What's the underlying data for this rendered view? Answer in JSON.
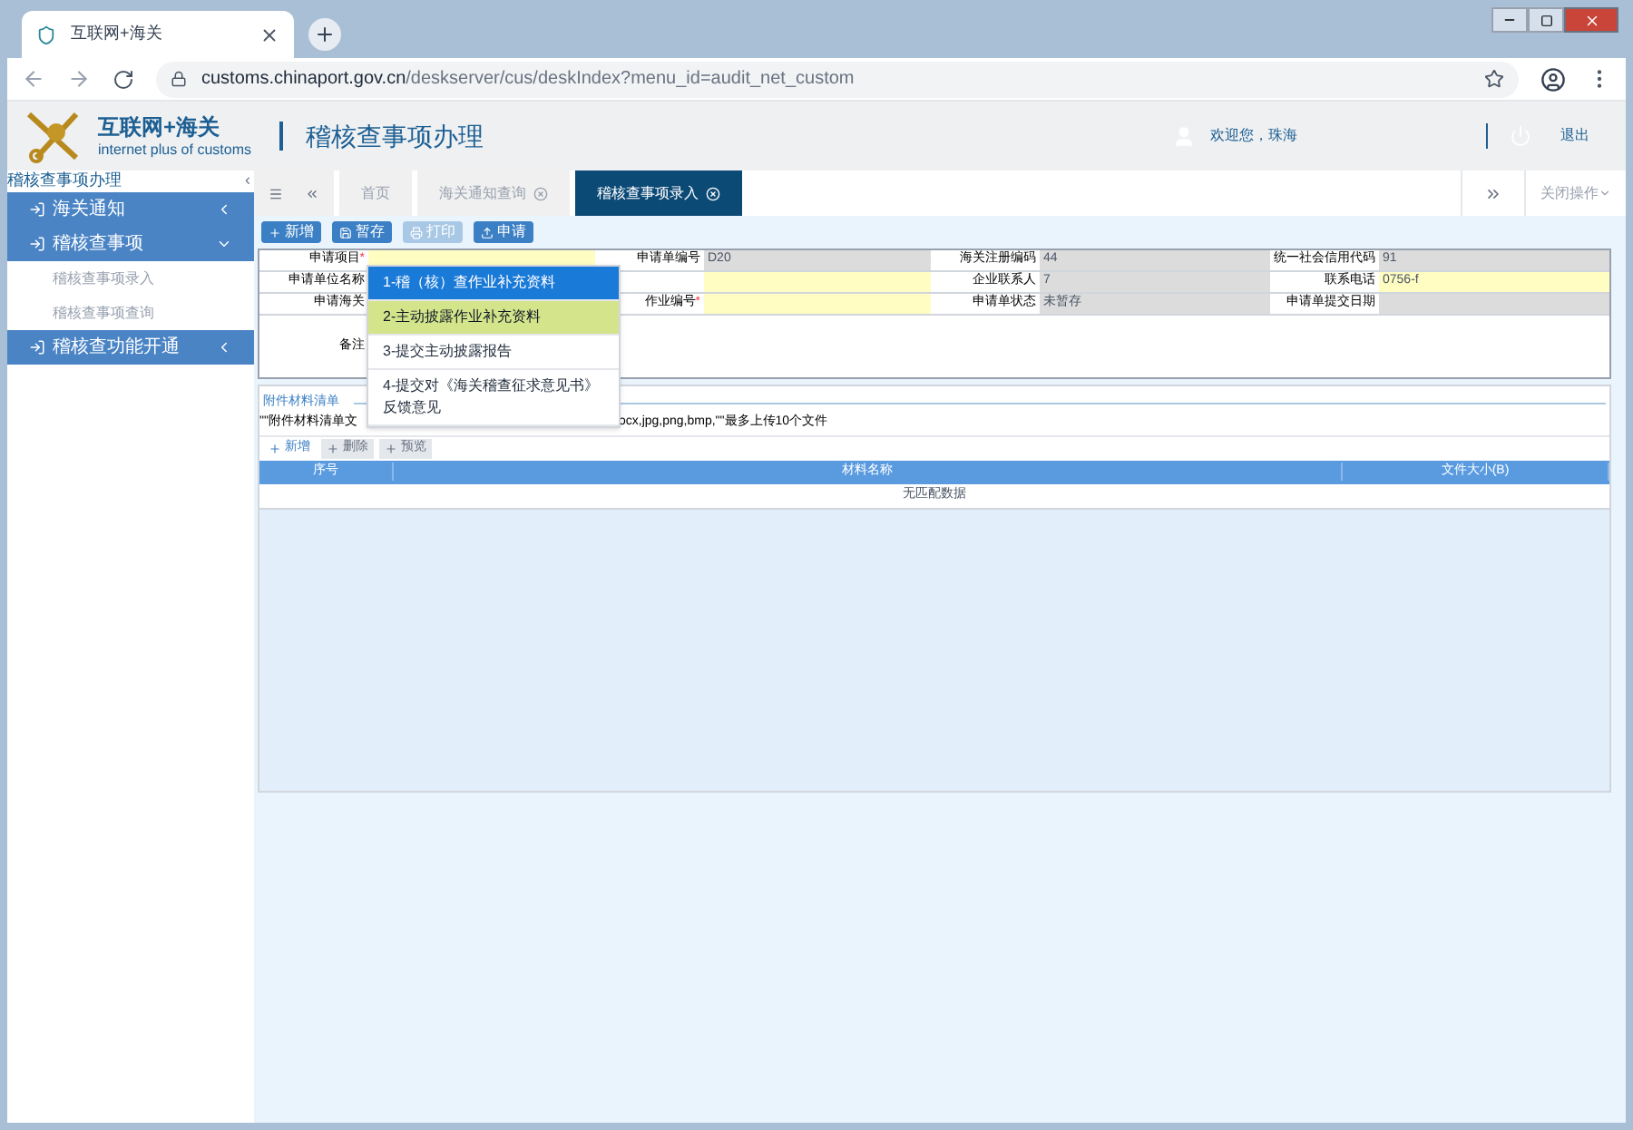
{
  "browser": {
    "tab_title": "互联网+海关",
    "url_host": "customs.chinaport.gov.cn",
    "url_path": "/deskserver/cus/deskIndex?menu_id=audit_net_custom"
  },
  "header": {
    "logo_title": "互联网+海关",
    "logo_subtitle": "internet plus of customs",
    "page_title": "稽核查事项办理",
    "welcome": "欢迎您，珠海",
    "logout": "退出"
  },
  "sidebar": {
    "title": "稽核查事项办理",
    "collapse": "‹",
    "items": [
      {
        "label": "海关通知",
        "expanded": false
      },
      {
        "label": "稽核查事项",
        "expanded": true,
        "children": [
          {
            "label": "稽核查事项录入"
          },
          {
            "label": "稽核查事项查询"
          }
        ]
      },
      {
        "label": "稽核查功能开通",
        "expanded": false
      }
    ]
  },
  "tabs": [
    {
      "label": "首页",
      "selected": false,
      "closable": false
    },
    {
      "label": "海关通知查询",
      "selected": false,
      "closable": true
    },
    {
      "label": "稽核查事项录入",
      "selected": true,
      "closable": true
    }
  ],
  "close_ops": "关闭操作",
  "toolbar": [
    {
      "label": "新增",
      "disabled": false
    },
    {
      "label": "暂存",
      "disabled": false
    },
    {
      "label": "打印",
      "disabled": true
    },
    {
      "label": "申请",
      "disabled": false
    }
  ],
  "form_rows": [
    [
      {
        "label": "申请项目",
        "required_mark": "*",
        "kind": "input"
      },
      {
        "label": "申请单编号",
        "value": "D20",
        "kind": "readonly"
      },
      {
        "label": "海关注册编码",
        "value": "44",
        "kind": "readonly"
      },
      {
        "label": "统一社会信用代码",
        "value": "91",
        "kind": "readonly"
      }
    ],
    [
      {
        "label": "申请单位名称"
      },
      {
        "kind": "input"
      },
      {
        "label": "企业联系人",
        "value": "7",
        "kind": "readonly"
      },
      {
        "label": "联系电话",
        "value": "0756-f",
        "kind": "input"
      }
    ],
    [
      {
        "label": "申请海关"
      },
      {
        "label": "作业编号",
        "required_mark": "*",
        "kind": "input"
      },
      {
        "label": "申请单状态",
        "value": "未暂存",
        "kind": "readonly"
      },
      {
        "label": "申请单提交日期",
        "kind": "readonly"
      }
    ]
  ],
  "remark_label": "备注",
  "dropdown": [
    {
      "label": "1-稽（核）查作业补充资料",
      "selected": true,
      "hovered": false
    },
    {
      "label": "2-主动披露作业补充资料",
      "selected": false,
      "hovered": true
    },
    {
      "label": "3-提交主动披露报告",
      "selected": false,
      "hovered": false
    },
    {
      "label": "4-提交对《海关稽查征求意见书》反馈意见",
      "selected": false,
      "hovered": false
    }
  ],
  "attachments": {
    "title": "附件材料清单",
    "note_start": "\"\"附件材料清单文",
    "note_end": "ocx,jpg,png,bmp,\"\"最多上传10个文件",
    "buttons": [
      {
        "label": "新增",
        "disabled": false
      },
      {
        "label": "删除",
        "disabled": true
      },
      {
        "label": "预览",
        "disabled": true
      }
    ],
    "columns": [
      "序号",
      "材料名称",
      "文件大小(B)"
    ],
    "empty": "无匹配数据"
  }
}
